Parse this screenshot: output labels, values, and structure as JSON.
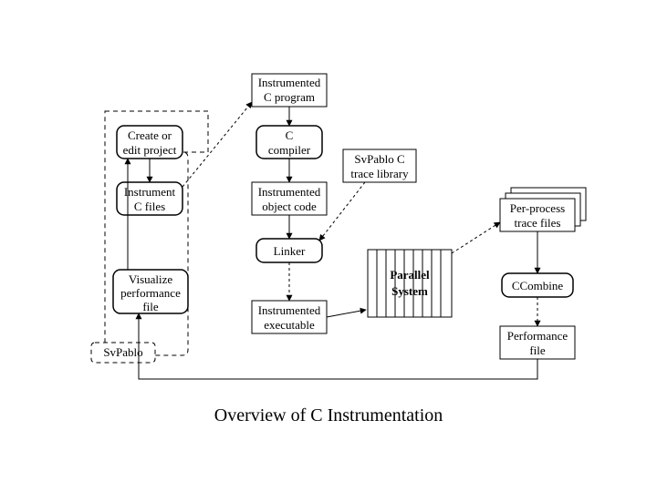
{
  "caption": "Overview of C Instrumentation",
  "nodes": {
    "instr_c_prog": {
      "l1": "Instrumented",
      "l2": "C program"
    },
    "create_edit": {
      "l1": "Create or",
      "l2": "edit project"
    },
    "c_compiler": {
      "l1": "C",
      "l2": "compiler"
    },
    "trace_lib": {
      "l1": "SvPablo C",
      "l2": "trace library"
    },
    "instr_cfiles": {
      "l1": "Instrument",
      "l2": "C files"
    },
    "instr_obj": {
      "l1": "Instrumented",
      "l2": "object code"
    },
    "perproc": {
      "l1": "Per-process",
      "l2": "trace files"
    },
    "linker": {
      "l1": "Linker"
    },
    "visualize": {
      "l1": "Visualize",
      "l2": "performance",
      "l3": "file"
    },
    "parallel": {
      "l1": "Parallel",
      "l2": "System"
    },
    "ccombine": {
      "l1": "CCombine"
    },
    "instr_exe": {
      "l1": "Instrumented",
      "l2": "executable"
    },
    "perf_file": {
      "l1": "Performance",
      "l2": "file"
    },
    "svpablo": {
      "l1": "SvPablo"
    }
  }
}
